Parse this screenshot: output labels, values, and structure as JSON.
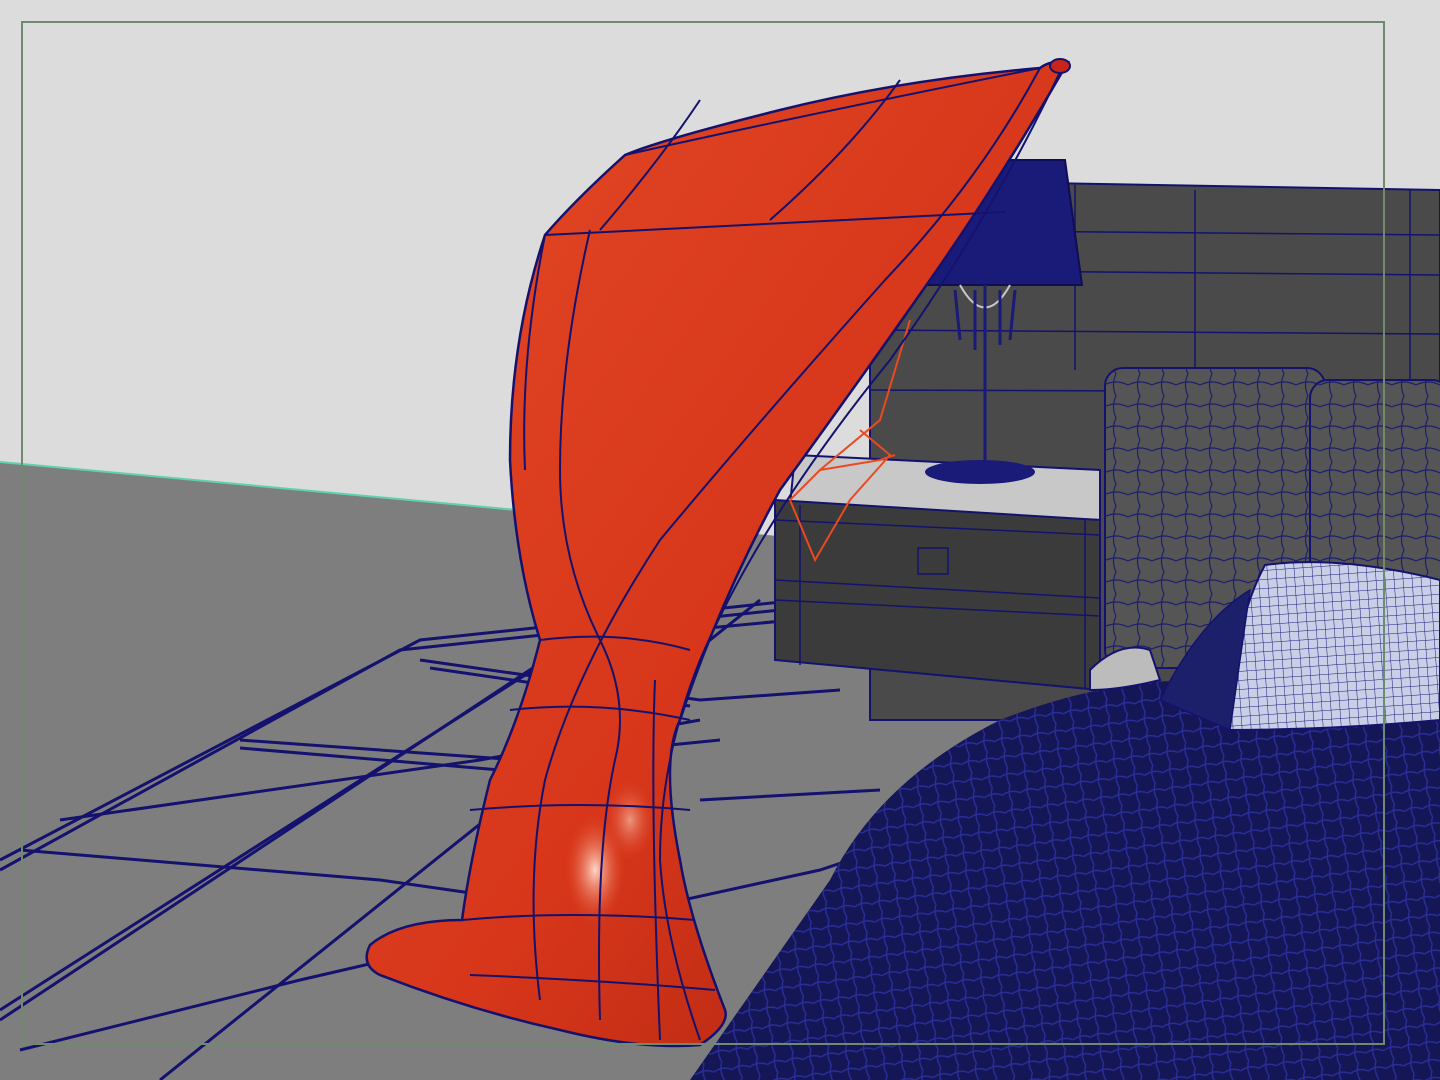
{
  "viewport": {
    "view_mode": "wireframe-on-shaded",
    "colors": {
      "background": "#dcdcdc",
      "floor": "#7d7d7d",
      "wireframe": "#14126e",
      "selected_object": "#d8341c",
      "selected_wire": "#ea4a22",
      "furniture": "#3e3e3e",
      "bed": "#131554",
      "pillow": "#c9cfe6",
      "resolution_gate": "#6f8a6f",
      "horizon_line": "#5fd0b0"
    }
  },
  "scene": {
    "objects": [
      {
        "name": "sculpture",
        "selected": true
      },
      {
        "name": "headboard",
        "selected": false
      },
      {
        "name": "nightstand",
        "selected": false
      },
      {
        "name": "table-lamp",
        "selected": false
      },
      {
        "name": "bed",
        "selected": false
      },
      {
        "name": "pillow",
        "selected": false
      },
      {
        "name": "floor-tiles",
        "selected": false
      }
    ]
  }
}
